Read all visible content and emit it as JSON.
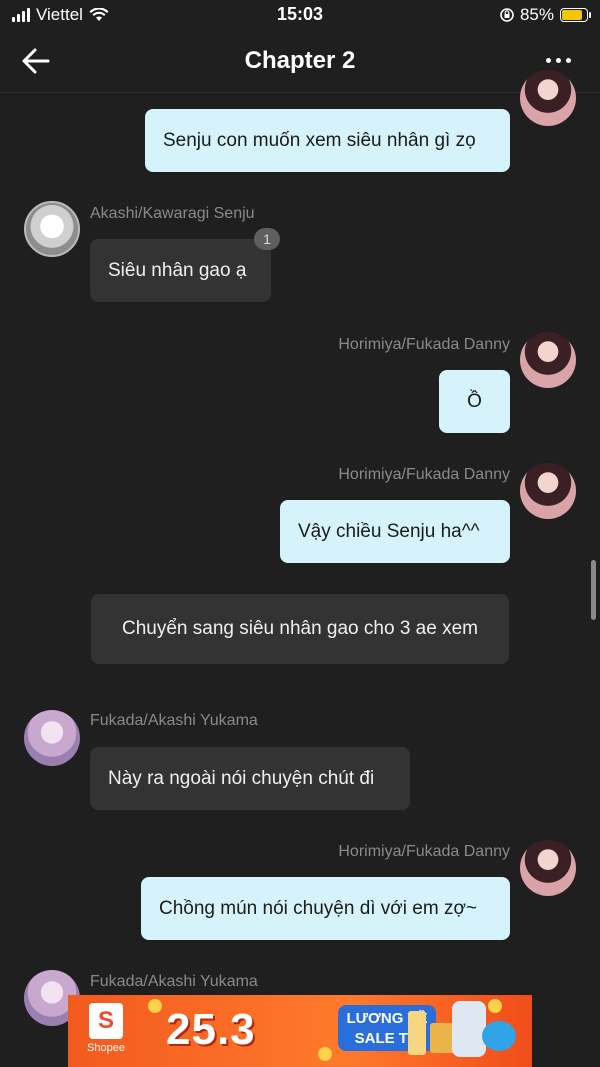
{
  "status": {
    "carrier": "Viettel",
    "time": "15:03",
    "battery": "85%",
    "battery_level": 0.85
  },
  "header": {
    "title": "Chapter 2"
  },
  "messages": [
    {
      "side": "right",
      "text": "Senju con muốn xem siêu nhân gì zọ"
    },
    {
      "side": "left",
      "name": "Akashi/Kawaragi Senju",
      "text": "Siêu nhân gao ạ",
      "badge": "1"
    },
    {
      "side": "right",
      "name": "Horimiya/Fukada Danny",
      "text": "Ồ"
    },
    {
      "side": "right",
      "name": "Horimiya/Fukada Danny",
      "text": "Vậy chiều Senju ha^^"
    },
    {
      "side": "center",
      "text": "Chuyển sang siêu nhân gao cho 3 ae xem"
    },
    {
      "side": "left",
      "name": "Fukada/Akashi Yukama",
      "text": "Này ra ngoài nói chuyện chút đi"
    },
    {
      "side": "right",
      "name": "Horimiya/Fukada Danny",
      "text": "Chồng mún nói chuyện dì với em zợ~"
    },
    {
      "side": "left",
      "name": "Fukada/Akashi Yukama"
    }
  ],
  "ad": {
    "brand": "Shopee",
    "headline": "25.3",
    "tag_line1": "LƯƠNG VỀ",
    "tag_line2": "SALE TO"
  },
  "colors": {
    "background": "#1f1f1f",
    "bubble_right": "#d6f3fb",
    "bubble_left": "#333333"
  }
}
